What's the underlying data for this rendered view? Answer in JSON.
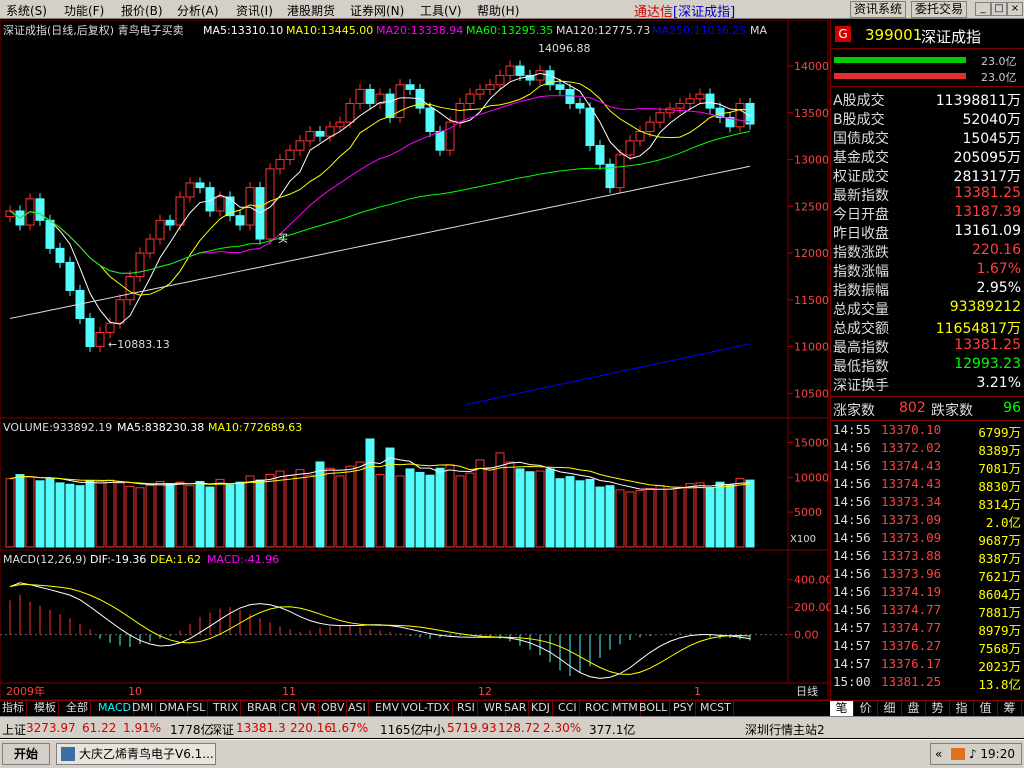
{
  "menu": [
    "系统(S)",
    "功能(F)",
    "报价(B)",
    "分析(A)",
    "资讯(I)",
    "港股期货",
    "证券网(N)",
    "工具(V)",
    "帮助(H)"
  ],
  "app_title": {
    "main": "通达信",
    "sub": "[深证成指]"
  },
  "top_buttons": [
    "资讯系统",
    "委托交易"
  ],
  "window_buttons": [
    "_",
    "□",
    "×"
  ],
  "chart_header": {
    "title": "深证成指(日线,后复权) 青鸟电子买卖",
    "ma5": "MA5:13310.10",
    "ma10": "MA10:13445.00",
    "ma20": "MA20:13338.94",
    "ma60": "MA60:13295.35",
    "ma120": "MA120:12775.73",
    "ma250": "MA250:11036.25",
    "ma_tail": "MA",
    "high_label": "14096.88",
    "low_label": "←10883.13",
    "buy_mark": "买"
  },
  "volume_header": {
    "vol": "VOLUME:933892.19",
    "ma5": "MA5:838230.38",
    "ma10": "MA10:772689.63",
    "unit": "X100"
  },
  "macd_header": {
    "name": "MACD(12,26,9)",
    "dif": "DIF:-19.36",
    "dea": "DEA:1.62",
    "macd": "MACD:-41.96"
  },
  "date_axis": {
    "year": "2009年",
    "months": [
      "10",
      "11",
      "12",
      "1"
    ],
    "period": "日线"
  },
  "colors": {
    "up": "#ff3232",
    "down": "#54fcfc",
    "ma5": "#ffffff",
    "ma10": "#ffff00",
    "ma20": "#ff00ff",
    "ma60": "#00ff00",
    "ma120": "#dddddd",
    "ma250": "#0000ff",
    "grid": "#800000"
  },
  "chart_data": [
    {
      "type": "candlestick",
      "title": "深证成指(日线,后复权)",
      "ylim": [
        10300,
        14300
      ],
      "y_ticks": [
        10500,
        11000,
        11500,
        12000,
        12500,
        13000,
        13500,
        14000
      ],
      "high": 14096.88,
      "low": 10883.13,
      "closes": [
        12450,
        12300,
        12580,
        12350,
        12050,
        11900,
        11600,
        11300,
        11000,
        11150,
        11250,
        11500,
        11750,
        12000,
        12150,
        12350,
        12300,
        12600,
        12750,
        12700,
        12450,
        12600,
        12400,
        12300,
        12700,
        12150,
        12900,
        13000,
        13100,
        13200,
        13300,
        13250,
        13350,
        13400,
        13600,
        13750,
        13600,
        13700,
        13450,
        13800,
        13750,
        13550,
        13300,
        13100,
        13400,
        13600,
        13700,
        13750,
        13800,
        13900,
        14000,
        13900,
        13850,
        13950,
        13800,
        13750,
        13600,
        13550,
        13150,
        12950,
        12700,
        13050,
        13200,
        13300,
        13400,
        13500,
        13550,
        13600,
        13650,
        13700,
        13550,
        13450,
        13350,
        13600,
        13380
      ]
    },
    {
      "type": "bar",
      "title": "VOLUME",
      "ylim": [
        0,
        16500
      ],
      "y_ticks": [
        5000,
        10000,
        15000
      ],
      "values": [
        9800,
        10400,
        10100,
        9500,
        9900,
        9200,
        9000,
        8800,
        9500,
        9400,
        9600,
        9200,
        8700,
        8500,
        8800,
        9400,
        9100,
        9300,
        8800,
        9400,
        8600,
        9700,
        8900,
        9300,
        10200,
        9600,
        10400,
        10900,
        10300,
        11100,
        10300,
        12200,
        11300,
        10200,
        11600,
        12200,
        15500,
        10400,
        14200,
        10200,
        11200,
        10700,
        10300,
        11300,
        11800,
        10200,
        10600,
        12500,
        11400,
        13500,
        12200,
        11200,
        10800,
        10900,
        11200,
        9800,
        10100,
        9500,
        9700,
        8600,
        8800,
        8200,
        7900,
        8100,
        8400,
        8800,
        8300,
        8600,
        9100,
        9200,
        8500,
        9300,
        8900,
        9800,
        9600
      ]
    },
    {
      "type": "bar",
      "title": "MACD(12,26,9)",
      "ylim": [
        -330,
        500
      ],
      "y_ticks": [
        0,
        200,
        400
      ],
      "values": [
        250,
        290,
        240,
        210,
        180,
        150,
        120,
        80,
        40,
        -30,
        -60,
        -80,
        -90,
        -70,
        -50,
        -30,
        -10,
        30,
        80,
        130,
        160,
        190,
        200,
        180,
        150,
        120,
        90,
        60,
        40,
        20,
        30,
        50,
        60,
        70,
        60,
        50,
        40,
        30,
        20,
        10,
        -10,
        -20,
        -30,
        -20,
        -10,
        -5,
        0,
        -10,
        -20,
        -30,
        -50,
        -80,
        -110,
        -150,
        -200,
        -260,
        -300,
        -280,
        -230,
        -170,
        -110,
        -70,
        -40,
        -20,
        -10,
        0,
        10,
        15,
        10,
        -5,
        -20,
        -30,
        -25,
        -35,
        -42
      ]
    }
  ],
  "right_panel": {
    "code": "399001",
    "name": "深证成指",
    "g": "G",
    "bar_labels": [
      "23.0亿",
      "23.0亿"
    ],
    "stats": [
      {
        "label": "A股成交",
        "value": "11398811万",
        "color": "#ffffff"
      },
      {
        "label": "B股成交",
        "value": "52040万",
        "color": "#ffffff"
      },
      {
        "label": "国债成交",
        "value": "15045万",
        "color": "#ffffff"
      },
      {
        "label": "基金成交",
        "value": "205095万",
        "color": "#ffffff"
      },
      {
        "label": "权证成交",
        "value": "281317万",
        "color": "#ffffff"
      },
      {
        "label": "最新指数",
        "value": "13381.25",
        "color": "#ff4040"
      },
      {
        "label": "今日开盘",
        "value": "13187.39",
        "color": "#ff4040"
      },
      {
        "label": "昨日收盘",
        "value": "13161.09",
        "color": "#ffffff"
      },
      {
        "label": "指数涨跌",
        "value": "220.16",
        "color": "#ff4040"
      },
      {
        "label": "指数涨幅",
        "value": "1.67%",
        "color": "#ff4040"
      },
      {
        "label": "指数振幅",
        "value": "2.95%",
        "color": "#ffffff"
      },
      {
        "label": "总成交量",
        "value": "93389212",
        "color": "#ffff00"
      },
      {
        "label": "总成交额",
        "value": "11654817万",
        "color": "#ffff00"
      },
      {
        "label": "最高指数",
        "value": "13381.25",
        "color": "#ff4040"
      },
      {
        "label": "最低指数",
        "value": "12993.23",
        "color": "#00ff00"
      },
      {
        "label": "深证换手",
        "value": "3.21%",
        "color": "#ffffff"
      }
    ],
    "breadth": {
      "up_label": "涨家数",
      "up": "802",
      "down_label": "跌家数",
      "down": "96"
    },
    "ticks": [
      {
        "t": "14:55",
        "p": "13370.10",
        "v": "6799万"
      },
      {
        "t": "14:56",
        "p": "13372.02",
        "v": "8389万"
      },
      {
        "t": "14:56",
        "p": "13374.43",
        "v": "7081万"
      },
      {
        "t": "14:56",
        "p": "13374.43",
        "v": "8830万"
      },
      {
        "t": "14:56",
        "p": "13373.34",
        "v": "8314万"
      },
      {
        "t": "14:56",
        "p": "13373.09",
        "v": "2.0亿"
      },
      {
        "t": "14:56",
        "p": "13373.09",
        "v": "9687万"
      },
      {
        "t": "14:56",
        "p": "13373.88",
        "v": "8387万"
      },
      {
        "t": "14:56",
        "p": "13373.96",
        "v": "7621万"
      },
      {
        "t": "14:56",
        "p": "13374.19",
        "v": "8604万"
      },
      {
        "t": "14:56",
        "p": "13374.77",
        "v": "7881万"
      },
      {
        "t": "14:57",
        "p": "13374.77",
        "v": "8979万"
      },
      {
        "t": "14:57",
        "p": "13376.27",
        "v": "7568万"
      },
      {
        "t": "14:57",
        "p": "13376.17",
        "v": "2023万"
      },
      {
        "t": "15:00",
        "p": "13381.25",
        "v": "13.8亿"
      }
    ],
    "tabs": [
      "笔",
      "价",
      "细",
      "盘",
      "势",
      "指",
      "值",
      "筹"
    ]
  },
  "indicator_tabs": [
    "指标",
    "模板",
    "全部",
    "MACD",
    "DMI",
    "DMA",
    "FSL",
    "TRIX",
    "BRAR",
    "CR",
    "VR",
    "OBV",
    "ASI",
    "EMV",
    "VOL-TDX",
    "RSI",
    "WR",
    "SAR",
    "KDJ",
    "CCI",
    "ROC",
    "MTM",
    "BOLL",
    "PSY",
    "MCST"
  ],
  "status_bar": {
    "sh_label": "上证",
    "sh_val": "3273.97",
    "sh_chg": "61.22",
    "sh_pct": "1.91%",
    "sh_amt": "1778亿",
    "sz_label": "深证",
    "sz_val": "13381.3",
    "sz_chg": "220.16",
    "sz_pct": "1.67%",
    "sz_amt": "1165亿",
    "zx_label": "中小",
    "zx_val": "5719.93",
    "zx_chg": "128.72",
    "zx_pct": "2.30%",
    "zx_amt": "377.1亿",
    "server": "深圳行情主站2"
  },
  "taskbar": {
    "start": "开始",
    "task": "大庆乙烯青鸟电子V6.1...",
    "time": "19:20"
  }
}
